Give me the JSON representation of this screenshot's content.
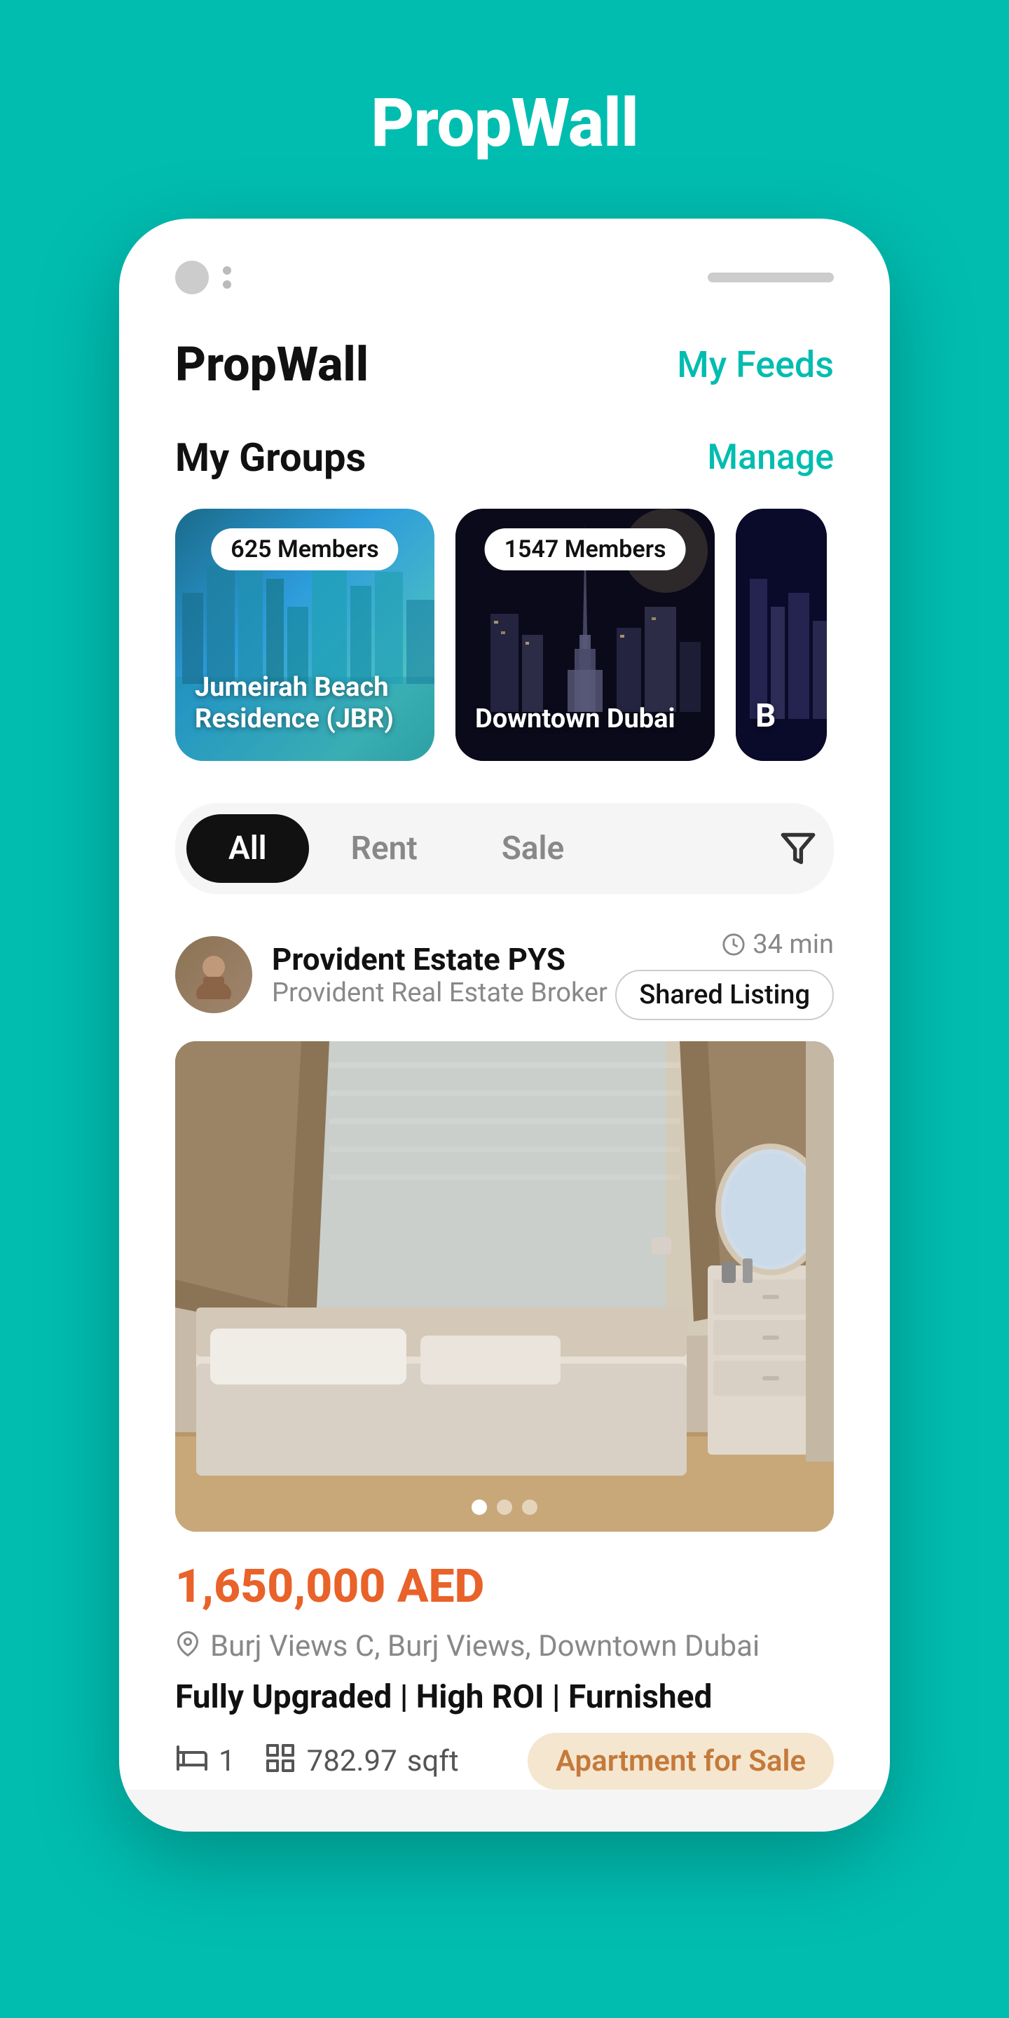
{
  "app": {
    "title": "PropWall",
    "tagline": "PropWall"
  },
  "header": {
    "logo": "PropWall",
    "my_feeds_label": "My Feeds"
  },
  "groups_section": {
    "title": "My Groups",
    "manage_label": "Manage",
    "groups": [
      {
        "id": "jbr",
        "name": "Jumeirah Beach Residence (JBR)",
        "members": "625 Members"
      },
      {
        "id": "downtown",
        "name": "Downtown Dubai",
        "members": "1547 Members"
      },
      {
        "id": "third",
        "name": "B",
        "members": ""
      }
    ]
  },
  "filter_tabs": {
    "tabs": [
      {
        "label": "All",
        "active": true
      },
      {
        "label": "Rent",
        "active": false
      },
      {
        "label": "Sale",
        "active": false
      }
    ],
    "filter_icon": "filter-icon"
  },
  "listing": {
    "agent_name": "Provident Estate PYS",
    "agent_company": "Provident Real Estate Broker",
    "time_ago": "34 min",
    "shared_label": "Shared Listing",
    "price": "1,650,000 AED",
    "location": "Burj Views C, Burj Views, Downtown Dubai",
    "title": "Fully Upgraded | High ROI | Furnished",
    "beds": "1",
    "sqft": "782.97",
    "sqft_label": "sqft",
    "property_type": "Apartment for Sale",
    "image_dots": 3,
    "active_dot": 0
  }
}
